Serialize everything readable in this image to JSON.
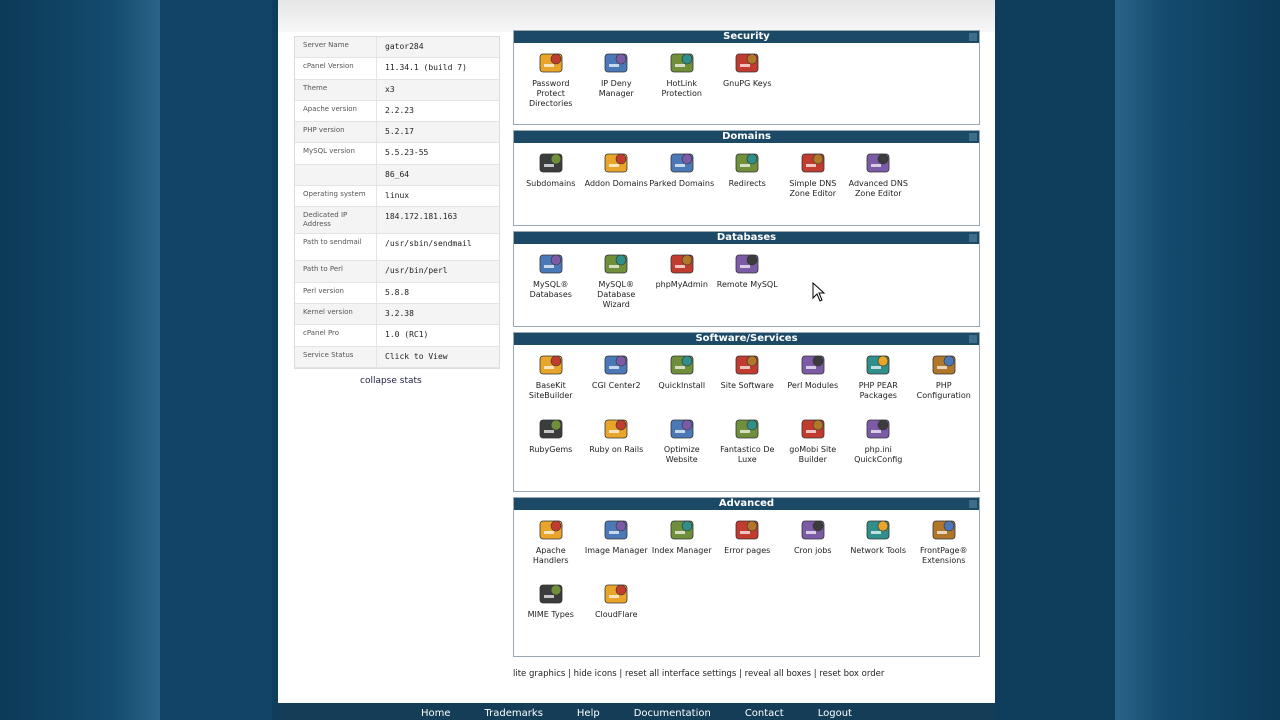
{
  "stats": [
    {
      "label": "Server Name",
      "value": "gator284"
    },
    {
      "label": "cPanel Version",
      "value": "11.34.1 (build 7)"
    },
    {
      "label": "Theme",
      "value": "x3"
    },
    {
      "label": "Apache version",
      "value": "2.2.23"
    },
    {
      "label": "PHP version",
      "value": "5.2.17"
    },
    {
      "label": "MySQL version",
      "value": "5.5.23-55"
    },
    {
      "label": "",
      "value": "86_64"
    },
    {
      "label": "Operating system",
      "value": "linux"
    },
    {
      "label": "Dedicated IP Address",
      "value": "184.172.181.163"
    },
    {
      "label": "Path to sendmail",
      "value": "/usr/sbin/sendmail"
    },
    {
      "label": "Path to Perl",
      "value": "/usr/bin/perl"
    },
    {
      "label": "Perl version",
      "value": "5.8.8"
    },
    {
      "label": "Kernel version",
      "value": "3.2.38"
    },
    {
      "label": "cPanel Pro",
      "value": "1.0 (RC1)"
    },
    {
      "label": "Service Status",
      "value": "Click to View"
    }
  ],
  "collapse_stats": "collapse stats",
  "sections": {
    "security": {
      "title": "Security",
      "items": [
        {
          "label": "Password Protect Directories",
          "icon": "folder-lock-icon"
        },
        {
          "label": "IP Deny Manager",
          "icon": "ip-deny-icon"
        },
        {
          "label": "HotLink Protection",
          "icon": "hotlink-icon"
        },
        {
          "label": "GnuPG Keys",
          "icon": "key-icon"
        }
      ]
    },
    "domains": {
      "title": "Domains",
      "items": [
        {
          "label": "Subdomains",
          "icon": "subdomains-icon"
        },
        {
          "label": "Addon Domains",
          "icon": "addon-domains-icon"
        },
        {
          "label": "Parked Domains",
          "icon": "parked-domains-icon"
        },
        {
          "label": "Redirects",
          "icon": "redirects-icon"
        },
        {
          "label": "Simple DNS Zone Editor",
          "icon": "dns-icon"
        },
        {
          "label": "Advanced DNS Zone Editor",
          "icon": "dns-advanced-icon"
        }
      ]
    },
    "databases": {
      "title": "Databases",
      "items": [
        {
          "label": "MySQL® Databases",
          "icon": "mysql-icon"
        },
        {
          "label": "MySQL® Database Wizard",
          "icon": "mysql-wizard-icon"
        },
        {
          "label": "phpMyAdmin",
          "icon": "phpmyadmin-icon"
        },
        {
          "label": "Remote MySQL",
          "icon": "remote-mysql-icon"
        }
      ]
    },
    "software": {
      "title": "Software/Services",
      "items": [
        {
          "label": "BaseKit SiteBuilder",
          "icon": "basekit-icon"
        },
        {
          "label": "CGI Center2",
          "icon": "cgi-icon"
        },
        {
          "label": "QuickInstall",
          "icon": "quickinstall-icon"
        },
        {
          "label": "Site Software",
          "icon": "site-software-icon"
        },
        {
          "label": "Perl Modules",
          "icon": "perl-icon"
        },
        {
          "label": "PHP PEAR Packages",
          "icon": "php-icon"
        },
        {
          "label": "PHP Configuration",
          "icon": "php-config-icon"
        },
        {
          "label": "RubyGems",
          "icon": "rubygems-icon"
        },
        {
          "label": "Ruby on Rails",
          "icon": "rails-icon"
        },
        {
          "label": "Optimize Website",
          "icon": "optimize-icon"
        },
        {
          "label": "Fantastico De Luxe",
          "icon": "fantastico-icon"
        },
        {
          "label": "goMobi Site Builder",
          "icon": "gomobi-icon"
        },
        {
          "label": "php.ini QuickConfig",
          "icon": "phpini-icon"
        }
      ]
    },
    "advanced": {
      "title": "Advanced",
      "items": [
        {
          "label": "Apache Handlers",
          "icon": "apache-icon"
        },
        {
          "label": "Image Manager",
          "icon": "image-manager-icon"
        },
        {
          "label": "Index Manager",
          "icon": "index-manager-icon"
        },
        {
          "label": "Error pages",
          "icon": "error-pages-icon"
        },
        {
          "label": "Cron jobs",
          "icon": "cron-icon"
        },
        {
          "label": "Network Tools",
          "icon": "network-tools-icon"
        },
        {
          "label": "FrontPage® Extensions",
          "icon": "frontpage-icon"
        },
        {
          "label": "MIME Types",
          "icon": "mime-icon"
        },
        {
          "label": "CloudFlare",
          "icon": "cloudflare-icon"
        }
      ]
    }
  },
  "footer_links": "lite graphics | hide icons | reset all interface settings | reveal all boxes | reset box order",
  "nav": [
    "Home",
    "Trademarks",
    "Help",
    "Documentation",
    "Contact",
    "Logout"
  ],
  "colors": {
    "header": "#1c4a66",
    "background": "#0f3d5c"
  }
}
